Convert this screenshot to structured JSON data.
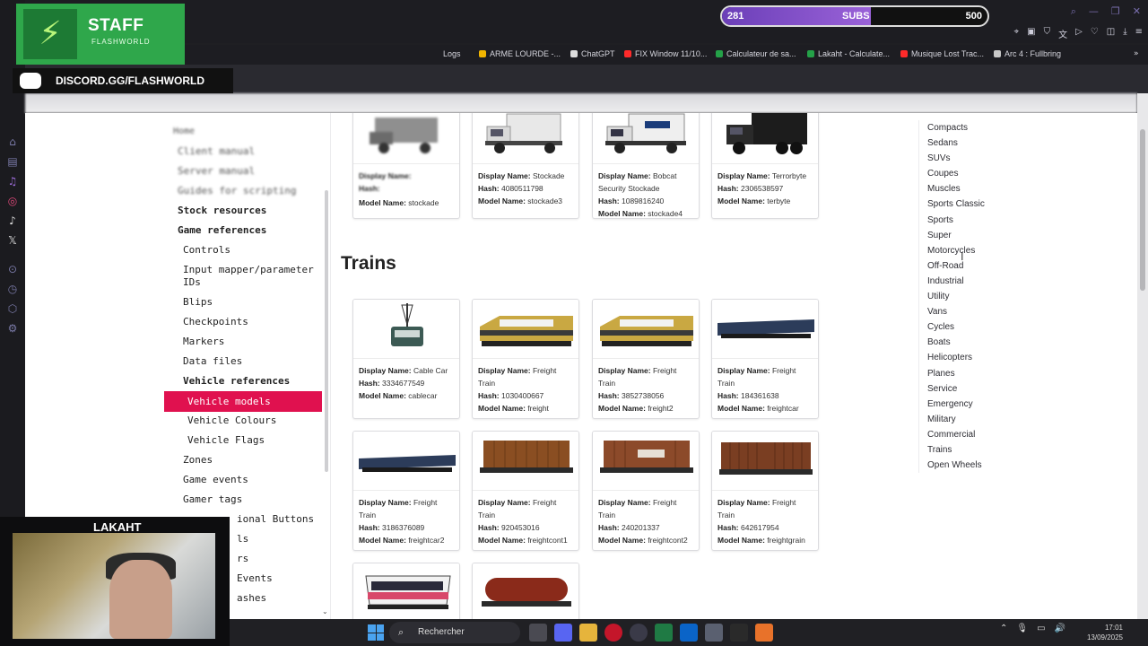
{
  "bookmarks": [
    {
      "label": "Logs",
      "color": "#2e8b3a"
    },
    {
      "label": "ARME LOURDE -...",
      "color": "#f0b400"
    },
    {
      "label": "ChatGPT",
      "color": "#dddddd"
    },
    {
      "label": "FIX Window 11/10...",
      "color": "#ff2a2a"
    },
    {
      "label": "Calculateur de sa...",
      "color": "#24a148"
    },
    {
      "label": "Lakaht - Calculate...",
      "color": "#24a148"
    },
    {
      "label": "Musique Lost Trac...",
      "color": "#ff2a2a"
    },
    {
      "label": "Arc 4 : Fullbring",
      "color": "#c8c8c8"
    }
  ],
  "overlay": {
    "staff_title": "STAFF",
    "staff_sub": "FLASHWORLD",
    "discord": "DISCORD.GG/FLASHWORLD",
    "subs_current": "281",
    "subs_label": "SUBS",
    "subs_goal": "500",
    "subs_progress": 0.562,
    "webcam_name": "LAKAHT"
  },
  "sidebar": {
    "blurred": [
      "Home",
      "Client manual",
      "Server manual",
      "Guides for scripting"
    ],
    "items": [
      {
        "label": "Stock resources",
        "style": "bold"
      },
      {
        "label": "Game references",
        "style": "bold"
      },
      {
        "label": "Controls",
        "style": "sub"
      },
      {
        "label": "Input mapper/parameter",
        "style": "sub"
      },
      {
        "label": "IDs",
        "style": "sub"
      },
      {
        "label": "Blips",
        "style": "sub"
      },
      {
        "label": "Checkpoints",
        "style": "sub"
      },
      {
        "label": "Markers",
        "style": "sub"
      },
      {
        "label": "Data files",
        "style": "sub"
      },
      {
        "label": "Vehicle references",
        "style": "subbold"
      },
      {
        "label": "Vehicle models",
        "style": "active"
      },
      {
        "label": "Vehicle Colours",
        "style": "subsub"
      },
      {
        "label": "Vehicle Flags",
        "style": "subsub"
      },
      {
        "label": "Zones",
        "style": "sub"
      },
      {
        "label": "Game events",
        "style": "sub"
      },
      {
        "label": "Gamer tags",
        "style": "sub"
      },
      {
        "label": "ional Buttons",
        "style": "sub"
      },
      {
        "label": "ls",
        "style": "sub"
      },
      {
        "label": "rs",
        "style": "sub"
      },
      {
        "label": "Events",
        "style": "sub"
      },
      {
        "label": "ashes",
        "style": "sub"
      }
    ]
  },
  "labels": {
    "display": "Display Name:",
    "hash": "Hash:",
    "model": "Model Name:"
  },
  "top_cards": [
    {
      "display": "",
      "hash": "",
      "model": "stockade"
    },
    {
      "display": "Stockade",
      "hash": "4080511798",
      "model": "stockade3"
    },
    {
      "display": "Bobcat Security Stockade",
      "hash": "1089816240",
      "model": "stockade4"
    },
    {
      "display": "Terrorbyte",
      "hash": "2306538597",
      "model": "terbyte"
    }
  ],
  "section_title": "Trains",
  "train_cards": [
    {
      "display": "Cable Car",
      "hash": "3334677549",
      "model": "cablecar",
      "icon": "cable-car-icon"
    },
    {
      "display": "Freight Train",
      "hash": "1030400667",
      "model": "freight",
      "icon": "locomotive-icon"
    },
    {
      "display": "Freight Train",
      "hash": "3852738056",
      "model": "freight2",
      "icon": "locomotive-icon"
    },
    {
      "display": "Freight Train",
      "hash": "184361638",
      "model": "freightcar",
      "icon": "flatcar-icon"
    },
    {
      "display": "Freight Train",
      "hash": "3186376089",
      "model": "freightcar2",
      "icon": "flatcar-icon"
    },
    {
      "display": "Freight Train",
      "hash": "920453016",
      "model": "freightcont1",
      "icon": "container-car-icon"
    },
    {
      "display": "Freight Train",
      "hash": "240201337",
      "model": "freightcont2",
      "icon": "container-car-icon"
    },
    {
      "display": "Freight Train",
      "hash": "642617954",
      "model": "freightgrain",
      "icon": "boxcar-icon"
    }
  ],
  "classes": [
    "Compacts",
    "Sedans",
    "SUVs",
    "Coupes",
    "Muscles",
    "Sports Classic",
    "Sports",
    "Super",
    "Motorcycles",
    "Off-Road",
    "Industrial",
    "Utility",
    "Vans",
    "Cycles",
    "Boats",
    "Helicopters",
    "Planes",
    "Service",
    "Emergency",
    "Military",
    "Commercial",
    "Trains",
    "Open Wheels"
  ],
  "taskbar": {
    "search_label": "Rechercher",
    "time": "17:01",
    "date": "13/09/2025"
  }
}
